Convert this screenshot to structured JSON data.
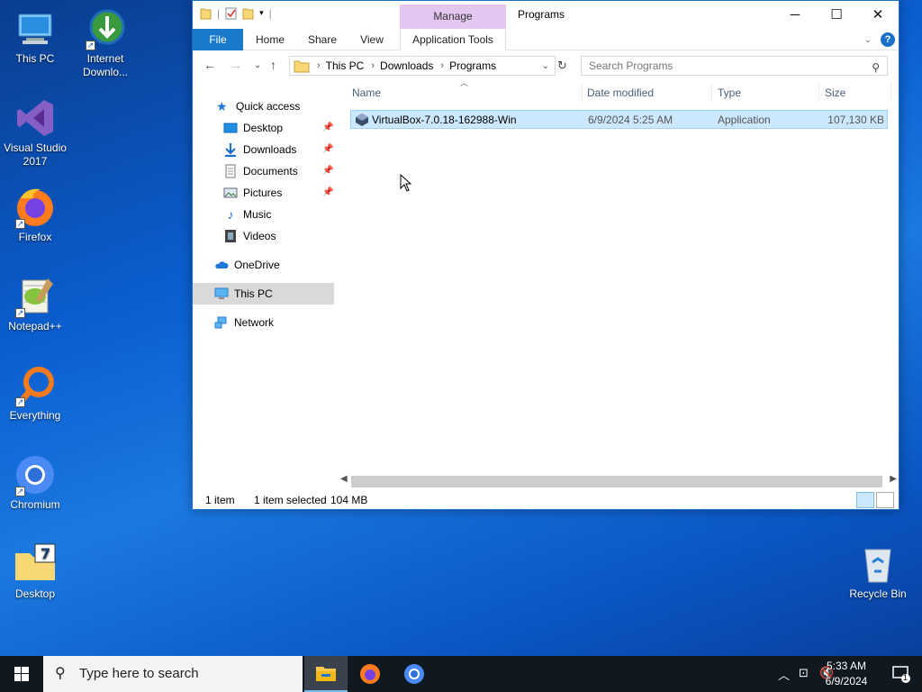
{
  "desktop": {
    "icons": [
      {
        "label": "This PC",
        "icon": "this-pc-icon"
      },
      {
        "label": "Internet Downlo...",
        "icon": "internet-download-manager-icon"
      },
      {
        "label": "Visual Studio 2017",
        "icon": "visual-studio-icon"
      },
      {
        "label": "Firefox",
        "icon": "firefox-icon"
      },
      {
        "label": "Notepad++",
        "icon": "notepad-plus-plus-icon"
      },
      {
        "label": "Everything",
        "icon": "everything-search-icon"
      },
      {
        "label": "Chromium",
        "icon": "chromium-icon"
      },
      {
        "label": "Desktop",
        "icon": "folder-icon"
      },
      {
        "label": "Recycle Bin",
        "icon": "recycle-bin-icon"
      }
    ]
  },
  "window": {
    "title": "Programs",
    "manage_label": "Manage",
    "ribbon_tabs": [
      "File",
      "Home",
      "Share",
      "View",
      "Application Tools"
    ],
    "breadcrumb": [
      "This PC",
      "Downloads",
      "Programs"
    ],
    "search_placeholder": "Search Programs",
    "nav": {
      "quick_access": "Quick access",
      "items": [
        "Desktop",
        "Downloads",
        "Documents",
        "Pictures",
        "Music",
        "Videos"
      ],
      "onedrive": "OneDrive",
      "this_pc": "This PC",
      "network": "Network"
    },
    "columns": [
      "Name",
      "Date modified",
      "Type",
      "Size"
    ],
    "files": [
      {
        "name": "VirtualBox-7.0.18-162988-Win",
        "date": "6/9/2024 5:25 AM",
        "type": "Application",
        "size": "107,130 KB"
      }
    ],
    "status": {
      "count": "1 item",
      "selected": "1 item selected",
      "size": "104 MB"
    }
  },
  "taskbar": {
    "search_placeholder": "Type here to search",
    "time": "5:33 AM",
    "date": "6/9/2024",
    "notification_count": "1"
  },
  "colors": {
    "accent": "#1979ca",
    "selection": "#cce8ff",
    "manage_tab": "#e4c7f0",
    "taskbar": "#101820"
  }
}
